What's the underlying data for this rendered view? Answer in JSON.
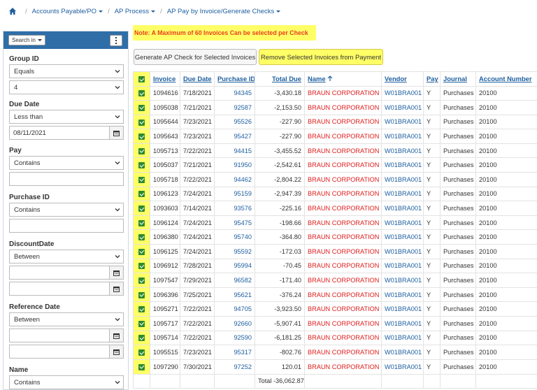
{
  "breadcrumb": {
    "items": [
      {
        "label": "Accounts Payable/PO"
      },
      {
        "label": "AP Process"
      },
      {
        "label": "AP Pay by Invoice/Generate Checks"
      }
    ]
  },
  "sidebar": {
    "search_in": "Search in",
    "filters": {
      "group_id": {
        "label": "Group ID",
        "operator": "Equals",
        "value": "4"
      },
      "due_date": {
        "label": "Due Date",
        "operator": "Less than",
        "value": "08/11/2021"
      },
      "pay": {
        "label": "Pay",
        "operator": "Contains",
        "value": ""
      },
      "purchase_id": {
        "label": "Purchase ID",
        "operator": "Contains",
        "value": ""
      },
      "discount_date": {
        "label": "DiscountDate",
        "operator": "Between",
        "from": "",
        "to": ""
      },
      "reference_date": {
        "label": "Reference Date",
        "operator": "Between",
        "from": "",
        "to": ""
      },
      "name": {
        "label": "Name",
        "operator": "Contains"
      }
    }
  },
  "note": "Note: A Maximum of 60 Invoices Can be selected per Check",
  "buttons": {
    "generate": "Generate AP Check for Selected Invoices",
    "remove": "Remove Selected Invoices from Payment"
  },
  "table": {
    "columns": {
      "invoice": "Invoice",
      "due_date": "Due Date",
      "purchase_id": "Purchase ID",
      "total_due": "Total Due",
      "name": "Name",
      "vendor": "Vendor",
      "pay": "Pay",
      "journal": "Journal",
      "account": "Account Number"
    },
    "rows": [
      {
        "invoice": "1094616",
        "due": "7/18/2021",
        "po": "94345",
        "total": "-3,430.18",
        "name": "BRAUN CORPORATION",
        "vendor": "W01BRA001",
        "pay": "Y",
        "journal": "Purchases",
        "account": "20100"
      },
      {
        "invoice": "1095038",
        "due": "7/21/2021",
        "po": "92587",
        "total": "-2,153.50",
        "name": "BRAUN CORPORATION",
        "vendor": "W01BRA001",
        "pay": "Y",
        "journal": "Purchases",
        "account": "20100"
      },
      {
        "invoice": "1095644",
        "due": "7/23/2021",
        "po": "95526",
        "total": "-227.90",
        "name": "BRAUN CORPORATION",
        "vendor": "W01BRA001",
        "pay": "Y",
        "journal": "Purchases",
        "account": "20100"
      },
      {
        "invoice": "1095643",
        "due": "7/23/2021",
        "po": "95427",
        "total": "-227.90",
        "name": "BRAUN CORPORATION",
        "vendor": "W01BRA001",
        "pay": "Y",
        "journal": "Purchases",
        "account": "20100"
      },
      {
        "invoice": "1095713",
        "due": "7/22/2021",
        "po": "94415",
        "total": "-3,455.52",
        "name": "BRAUN CORPORATION",
        "vendor": "W01BRA001",
        "pay": "Y",
        "journal": "Purchases",
        "account": "20100"
      },
      {
        "invoice": "1095037",
        "due": "7/21/2021",
        "po": "91950",
        "total": "-2,542.61",
        "name": "BRAUN CORPORATION",
        "vendor": "W01BRA001",
        "pay": "Y",
        "journal": "Purchases",
        "account": "20100"
      },
      {
        "invoice": "1095718",
        "due": "7/22/2021",
        "po": "94462",
        "total": "-2,804.22",
        "name": "BRAUN CORPORATION",
        "vendor": "W01BRA001",
        "pay": "Y",
        "journal": "Purchases",
        "account": "20100"
      },
      {
        "invoice": "1096123",
        "due": "7/24/2021",
        "po": "95159",
        "total": "-2,947.39",
        "name": "BRAUN CORPORATION",
        "vendor": "W01BRA001",
        "pay": "Y",
        "journal": "Purchases",
        "account": "20100"
      },
      {
        "invoice": "1093603",
        "due": "7/14/2021",
        "po": "93576",
        "total": "-225.16",
        "name": "BRAUN CORPORATION",
        "vendor": "W01BRA001",
        "pay": "Y",
        "journal": "Purchases",
        "account": "20100"
      },
      {
        "invoice": "1096124",
        "due": "7/24/2021",
        "po": "95475",
        "total": "-198.66",
        "name": "BRAUN CORPORATION",
        "vendor": "W01BRA001",
        "pay": "Y",
        "journal": "Purchases",
        "account": "20100"
      },
      {
        "invoice": "1096380",
        "due": "7/24/2021",
        "po": "95740",
        "total": "-364.80",
        "name": "BRAUN CORPORATION",
        "vendor": "W01BRA001",
        "pay": "Y",
        "journal": "Purchases",
        "account": "20100"
      },
      {
        "invoice": "1096125",
        "due": "7/24/2021",
        "po": "95592",
        "total": "-172.03",
        "name": "BRAUN CORPORATION",
        "vendor": "W01BRA001",
        "pay": "Y",
        "journal": "Purchases",
        "account": "20100"
      },
      {
        "invoice": "1096912",
        "due": "7/28/2021",
        "po": "95994",
        "total": "-70.45",
        "name": "BRAUN CORPORATION",
        "vendor": "W01BRA001",
        "pay": "Y",
        "journal": "Purchases",
        "account": "20100"
      },
      {
        "invoice": "1097547",
        "due": "7/29/2021",
        "po": "96582",
        "total": "-171.40",
        "name": "BRAUN CORPORATION",
        "vendor": "W01BRA001",
        "pay": "Y",
        "journal": "Purchases",
        "account": "20100"
      },
      {
        "invoice": "1096396",
        "due": "7/25/2021",
        "po": "95621",
        "total": "-376.24",
        "name": "BRAUN CORPORATION",
        "vendor": "W01BRA001",
        "pay": "Y",
        "journal": "Purchases",
        "account": "20100"
      },
      {
        "invoice": "1095271",
        "due": "7/22/2021",
        "po": "94705",
        "total": "-3,923.50",
        "name": "BRAUN CORPORATION",
        "vendor": "W01BRA001",
        "pay": "Y",
        "journal": "Purchases",
        "account": "20100"
      },
      {
        "invoice": "1095717",
        "due": "7/22/2021",
        "po": "92660",
        "total": "-5,907.41",
        "name": "BRAUN CORPORATION",
        "vendor": "W01BRA001",
        "pay": "Y",
        "journal": "Purchases",
        "account": "20100"
      },
      {
        "invoice": "1095714",
        "due": "7/22/2021",
        "po": "92590",
        "total": "-6,181.25",
        "name": "BRAUN CORPORATION",
        "vendor": "W01BRA001",
        "pay": "Y",
        "journal": "Purchases",
        "account": "20100"
      },
      {
        "invoice": "1095515",
        "due": "7/23/2021",
        "po": "95317",
        "total": "-802.76",
        "name": "BRAUN CORPORATION",
        "vendor": "W01BRA001",
        "pay": "Y",
        "journal": "Purchases",
        "account": "20100"
      },
      {
        "invoice": "1097290",
        "due": "7/30/2021",
        "po": "97252",
        "total": "120.01",
        "name": "BRAUN CORPORATION",
        "vendor": "W01BRA001",
        "pay": "Y",
        "journal": "Purchases",
        "account": "20100"
      }
    ],
    "total": "Total -36,062.87"
  },
  "colors": {
    "accent": "#2f6ea7",
    "link": "#1f5fa0",
    "highlight": "#ffff66",
    "name_red": "#e01c1c",
    "check_green": "#2e8b2e"
  }
}
